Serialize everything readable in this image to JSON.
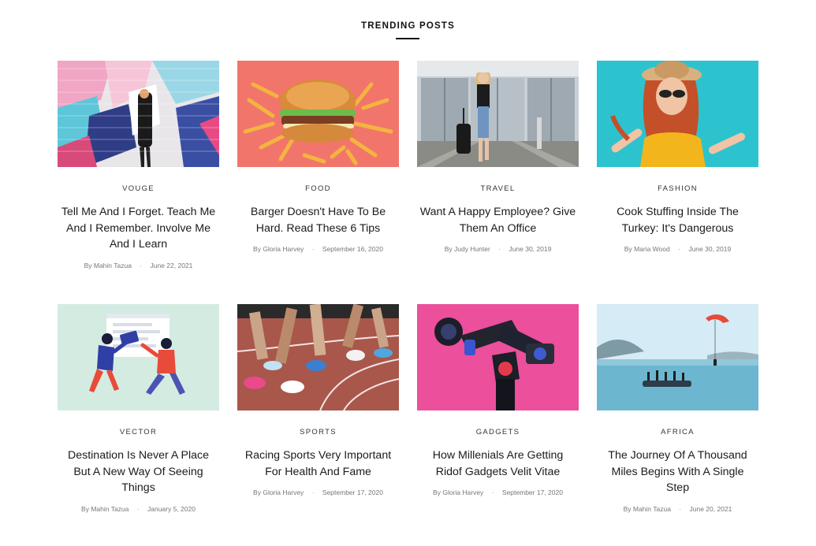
{
  "section": {
    "title": "TRENDING POSTS"
  },
  "posts": [
    {
      "category": "VOUGE",
      "title": "Tell Me And I Forget. Teach Me And I Remember. Involve Me And I Learn",
      "by": "By",
      "author": "Mahin Tazua",
      "date": "June 22, 2021"
    },
    {
      "category": "FOOD",
      "title": "Barger Doesn't Have To Be Hard. Read These 6 Tips",
      "by": "By",
      "author": "Gloria Harvey",
      "date": "September 16, 2020"
    },
    {
      "category": "TRAVEL",
      "title": "Want A Happy Employee? Give Them An Office",
      "by": "By",
      "author": "Judy Hunter",
      "date": "June 30, 2019"
    },
    {
      "category": "FASHION",
      "title": "Cook Stuffing Inside The Turkey: It's Dangerous",
      "by": "By",
      "author": "Maria Wood",
      "date": "June 30, 2019"
    },
    {
      "category": "VECTOR",
      "title": "Destination Is Never A Place But A New Way Of Seeing Things",
      "by": "By",
      "author": "Mahin Tazua",
      "date": "January 5, 2020"
    },
    {
      "category": "SPORTS",
      "title": "Racing Sports Very Important For Health And Fame",
      "by": "By",
      "author": "Gloria Harvey",
      "date": "September 17, 2020"
    },
    {
      "category": "GADGETS",
      "title": "How Millenials Are Getting Ridof Gadgets Velit Vitae",
      "by": "By",
      "author": "Gloria Harvey",
      "date": "September 17, 2020"
    },
    {
      "category": "AFRICA",
      "title": "The Journey Of A Thousand Miles Begins With A Single Step",
      "by": "By",
      "author": "Mahin Tazua",
      "date": "June 20, 2021"
    }
  ]
}
